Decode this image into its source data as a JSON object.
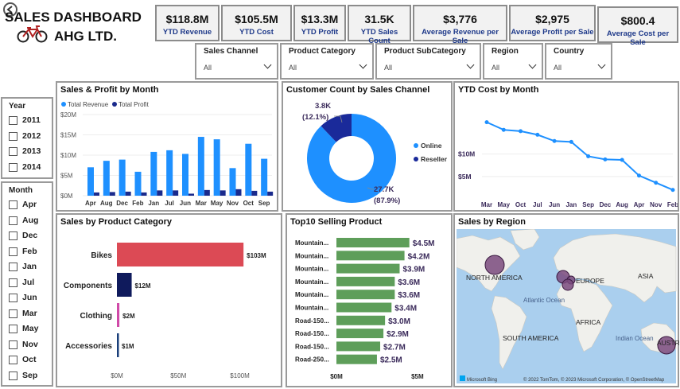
{
  "header": {
    "title": "SALES DASHBOARD",
    "subtitle": "AHG LTD."
  },
  "kpis": [
    {
      "value": "$118.8M",
      "label": "YTD Revenue"
    },
    {
      "value": "$105.5M",
      "label": "YTD Cost"
    },
    {
      "value": "$13.3M",
      "label": "YTD Profit"
    },
    {
      "value": "31.5K",
      "label": "YTD Sales Count"
    },
    {
      "value": "$3,776",
      "label": "Average Revenue per Sale"
    },
    {
      "value": "$2,975",
      "label": "Average Profit per Sale"
    },
    {
      "value": "$800.4",
      "label": "Average Cost per Sale"
    }
  ],
  "filters": [
    {
      "label": "Sales Channel",
      "value": "All"
    },
    {
      "label": "Product Category",
      "value": "All"
    },
    {
      "label": "Product SubCategory",
      "value": "All"
    },
    {
      "label": "Region",
      "value": "All"
    },
    {
      "label": "Country",
      "value": "All"
    }
  ],
  "slicers": {
    "year": {
      "title": "Year",
      "items": [
        "2011",
        "2012",
        "2013",
        "2014"
      ]
    },
    "month": {
      "title": "Month",
      "items": [
        "Apr",
        "Aug",
        "Dec",
        "Feb",
        "Jan",
        "Jul",
        "Jun",
        "Mar",
        "May",
        "Nov",
        "Oct",
        "Sep"
      ]
    }
  },
  "colors": {
    "revenue": "#1e90ff",
    "profit": "#1a2a8c",
    "bikes": "#dc4a55",
    "components": "#0f1a5c",
    "clothing": "#d04aa8",
    "accessories": "#1a3f7a",
    "top10": "#5e9e5a",
    "ytdcost": "#1e90ff",
    "online": "#1e90ff",
    "reseller": "#1a2a9a",
    "map_water": "#aacfee",
    "map_land": "#f0f0ec",
    "map_bubble": "#7a4a7e"
  },
  "panels": {
    "sales_profit": "Sales & Profit by Month",
    "customer": "Customer Count by Sales Channel",
    "ytd_cost": "YTD Cost by Month",
    "category": "Sales by Product Category",
    "top10": "Top10 Selling Product",
    "region": "Sales by Region"
  },
  "map": {
    "labels": [
      "NORTH AMERICA",
      "EUROPE",
      "ASIA",
      "AFRICA",
      "SOUTH AMERICA",
      "AUSTRALIA",
      "Atlantic Ocean",
      "Indian Ocean"
    ],
    "attribution": "© 2022 TomTom, © 2023 Microsoft Corporation, © OpenStreetMap",
    "brand": "Microsoft Bing"
  },
  "chart_data": [
    {
      "type": "bar",
      "title": "Sales & Profit by Month",
      "categories": [
        "Apr",
        "Aug",
        "Dec",
        "Feb",
        "Jan",
        "Jul",
        "Jun",
        "Mar",
        "May",
        "Nov",
        "Oct",
        "Sep"
      ],
      "series": [
        {
          "name": "Total Revenue",
          "values": [
            7.0,
            8.6,
            8.9,
            5.9,
            10.8,
            11.2,
            10.3,
            14.5,
            13.9,
            6.8,
            12.8,
            9.1
          ]
        },
        {
          "name": "Total Profit",
          "values": [
            0.8,
            0.9,
            1.0,
            0.8,
            1.3,
            1.3,
            0.5,
            1.4,
            1.3,
            1.6,
            1.2,
            1.0
          ]
        }
      ],
      "yticks": [
        "$0M",
        "$5M",
        "$10M",
        "$15M",
        "$20M"
      ],
      "ylim": [
        0,
        20
      ],
      "legend": "top-left"
    },
    {
      "type": "pie",
      "title": "Customer Count by Sales Channel",
      "categories": [
        "Online",
        "Reseller"
      ],
      "values": [
        27.7,
        3.8
      ],
      "data_labels": [
        "27.7K",
        "3.8K"
      ],
      "percent_labels": [
        "(87.9%)",
        "(12.1%)"
      ],
      "legend": "right"
    },
    {
      "type": "line",
      "title": "YTD Cost by Month",
      "categories": [
        "Mar",
        "May",
        "Oct",
        "Jul",
        "Jun",
        "Jan",
        "Sep",
        "Dec",
        "Aug",
        "Apr",
        "Nov",
        "Feb"
      ],
      "values": [
        12.1,
        10.4,
        10.1,
        9.3,
        7.9,
        7.7,
        4.5,
        3.8,
        3.7,
        0.2,
        -1.4,
        -3.0
      ],
      "yticks": [
        "$5M",
        "$10M"
      ],
      "ylim": [
        -5,
        17
      ]
    },
    {
      "type": "bar",
      "title": "Sales by Product Category",
      "categories": [
        "Bikes",
        "Components",
        "Clothing",
        "Accessories"
      ],
      "values": [
        103,
        12,
        2,
        1
      ],
      "data_labels": [
        "$103M",
        "$12M",
        "$2M",
        "$1M"
      ],
      "xticks": [
        "$0M",
        "$50M",
        "$100M"
      ],
      "xlim": [
        0,
        110
      ]
    },
    {
      "type": "bar",
      "title": "Top10 Selling Product",
      "categories": [
        "Mountain...",
        "Mountain...",
        "Mountain...",
        "Mountain...",
        "Mountain...",
        "Mountain...",
        "Road-150...",
        "Road-150...",
        "Road-150...",
        "Road-250..."
      ],
      "values": [
        4.5,
        4.2,
        3.9,
        3.6,
        3.6,
        3.4,
        3.0,
        2.9,
        2.7,
        2.5
      ],
      "data_labels": [
        "$4.5M",
        "$4.2M",
        "$3.9M",
        "$3.6M",
        "$3.6M",
        "$3.4M",
        "$3.0M",
        "$2.9M",
        "$2.7M",
        "$2.5M"
      ],
      "xticks": [
        "$0M",
        "$5M"
      ],
      "xlim": [
        0,
        5.3
      ]
    }
  ]
}
